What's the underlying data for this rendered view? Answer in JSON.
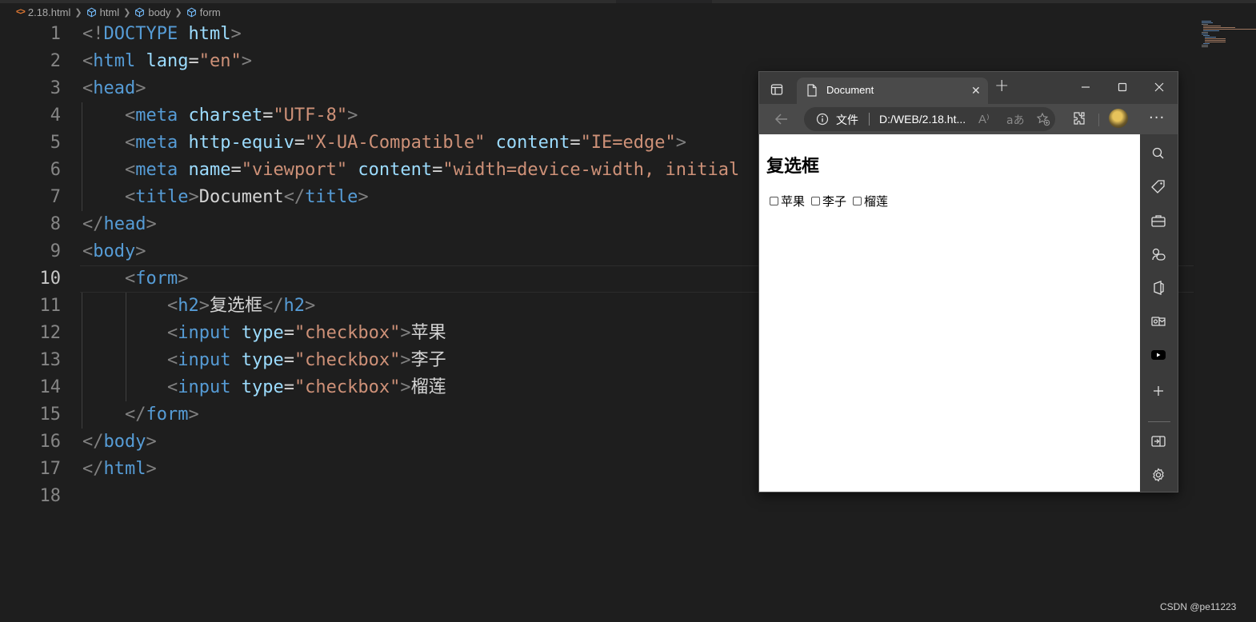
{
  "breadcrumb": {
    "file": "2.18.html",
    "items": [
      "html",
      "body",
      "form"
    ]
  },
  "editor": {
    "active_line": 10,
    "lines": [
      {
        "n": "1",
        "tokens": [
          {
            "c": "p",
            "t": "<!"
          },
          {
            "c": "tg",
            "t": "DOCTYPE"
          },
          {
            "c": "tx",
            "t": " "
          },
          {
            "c": "at",
            "t": "html"
          },
          {
            "c": "p",
            "t": ">"
          }
        ]
      },
      {
        "n": "2",
        "tokens": [
          {
            "c": "p",
            "t": "<"
          },
          {
            "c": "tg",
            "t": "html"
          },
          {
            "c": "tx",
            "t": " "
          },
          {
            "c": "at",
            "t": "lang"
          },
          {
            "c": "eq",
            "t": "="
          },
          {
            "c": "st",
            "t": "\"en\""
          },
          {
            "c": "p",
            "t": ">"
          }
        ]
      },
      {
        "n": "3",
        "tokens": [
          {
            "c": "p",
            "t": "<"
          },
          {
            "c": "tg",
            "t": "head"
          },
          {
            "c": "p",
            "t": ">"
          }
        ]
      },
      {
        "n": "4",
        "tokens": [
          {
            "c": "tx",
            "t": "    "
          },
          {
            "c": "p",
            "t": "<"
          },
          {
            "c": "tg",
            "t": "meta"
          },
          {
            "c": "tx",
            "t": " "
          },
          {
            "c": "at",
            "t": "charset"
          },
          {
            "c": "eq",
            "t": "="
          },
          {
            "c": "st",
            "t": "\"UTF-8\""
          },
          {
            "c": "p",
            "t": ">"
          }
        ]
      },
      {
        "n": "5",
        "tokens": [
          {
            "c": "tx",
            "t": "    "
          },
          {
            "c": "p",
            "t": "<"
          },
          {
            "c": "tg",
            "t": "meta"
          },
          {
            "c": "tx",
            "t": " "
          },
          {
            "c": "at",
            "t": "http-equiv"
          },
          {
            "c": "eq",
            "t": "="
          },
          {
            "c": "st",
            "t": "\"X-UA-Compatible\""
          },
          {
            "c": "tx",
            "t": " "
          },
          {
            "c": "at",
            "t": "content"
          },
          {
            "c": "eq",
            "t": "="
          },
          {
            "c": "st",
            "t": "\"IE=edge\""
          },
          {
            "c": "p",
            "t": ">"
          }
        ]
      },
      {
        "n": "6",
        "tokens": [
          {
            "c": "tx",
            "t": "    "
          },
          {
            "c": "p",
            "t": "<"
          },
          {
            "c": "tg",
            "t": "meta"
          },
          {
            "c": "tx",
            "t": " "
          },
          {
            "c": "at",
            "t": "name"
          },
          {
            "c": "eq",
            "t": "="
          },
          {
            "c": "st",
            "t": "\"viewport\""
          },
          {
            "c": "tx",
            "t": " "
          },
          {
            "c": "at",
            "t": "content"
          },
          {
            "c": "eq",
            "t": "="
          },
          {
            "c": "st",
            "t": "\"width=device-width, initial"
          }
        ]
      },
      {
        "n": "7",
        "tokens": [
          {
            "c": "tx",
            "t": "    "
          },
          {
            "c": "p",
            "t": "<"
          },
          {
            "c": "tg",
            "t": "title"
          },
          {
            "c": "p",
            "t": ">"
          },
          {
            "c": "tx",
            "t": "Document"
          },
          {
            "c": "p",
            "t": "</"
          },
          {
            "c": "tg",
            "t": "title"
          },
          {
            "c": "p",
            "t": ">"
          }
        ]
      },
      {
        "n": "8",
        "tokens": [
          {
            "c": "p",
            "t": "</"
          },
          {
            "c": "tg",
            "t": "head"
          },
          {
            "c": "p",
            "t": ">"
          }
        ]
      },
      {
        "n": "9",
        "tokens": [
          {
            "c": "p",
            "t": "<"
          },
          {
            "c": "tg",
            "t": "body"
          },
          {
            "c": "p",
            "t": ">"
          }
        ]
      },
      {
        "n": "10",
        "tokens": [
          {
            "c": "tx",
            "t": "    "
          },
          {
            "c": "p",
            "t": "<"
          },
          {
            "c": "tg",
            "t": "form"
          },
          {
            "c": "p",
            "t": ">"
          }
        ]
      },
      {
        "n": "11",
        "tokens": [
          {
            "c": "tx",
            "t": "        "
          },
          {
            "c": "p",
            "t": "<"
          },
          {
            "c": "tg",
            "t": "h2"
          },
          {
            "c": "p",
            "t": ">"
          },
          {
            "c": "tx",
            "t": "复选框"
          },
          {
            "c": "p",
            "t": "</"
          },
          {
            "c": "tg",
            "t": "h2"
          },
          {
            "c": "p",
            "t": ">"
          }
        ]
      },
      {
        "n": "12",
        "tokens": [
          {
            "c": "tx",
            "t": "        "
          },
          {
            "c": "p",
            "t": "<"
          },
          {
            "c": "tg",
            "t": "input"
          },
          {
            "c": "tx",
            "t": " "
          },
          {
            "c": "at",
            "t": "type"
          },
          {
            "c": "eq",
            "t": "="
          },
          {
            "c": "st",
            "t": "\"checkbox\""
          },
          {
            "c": "p",
            "t": ">"
          },
          {
            "c": "tx",
            "t": "苹果"
          }
        ]
      },
      {
        "n": "13",
        "tokens": [
          {
            "c": "tx",
            "t": "        "
          },
          {
            "c": "p",
            "t": "<"
          },
          {
            "c": "tg",
            "t": "input"
          },
          {
            "c": "tx",
            "t": " "
          },
          {
            "c": "at",
            "t": "type"
          },
          {
            "c": "eq",
            "t": "="
          },
          {
            "c": "st",
            "t": "\"checkbox\""
          },
          {
            "c": "p",
            "t": ">"
          },
          {
            "c": "tx",
            "t": "李子"
          }
        ]
      },
      {
        "n": "14",
        "tokens": [
          {
            "c": "tx",
            "t": "        "
          },
          {
            "c": "p",
            "t": "<"
          },
          {
            "c": "tg",
            "t": "input"
          },
          {
            "c": "tx",
            "t": " "
          },
          {
            "c": "at",
            "t": "type"
          },
          {
            "c": "eq",
            "t": "="
          },
          {
            "c": "st",
            "t": "\"checkbox\""
          },
          {
            "c": "p",
            "t": ">"
          },
          {
            "c": "tx",
            "t": "榴莲"
          }
        ]
      },
      {
        "n": "15",
        "tokens": [
          {
            "c": "tx",
            "t": "    "
          },
          {
            "c": "p",
            "t": "</"
          },
          {
            "c": "tg",
            "t": "form"
          },
          {
            "c": "p",
            "t": ">"
          }
        ]
      },
      {
        "n": "16",
        "tokens": [
          {
            "c": "p",
            "t": "</"
          },
          {
            "c": "tg",
            "t": "body"
          },
          {
            "c": "p",
            "t": ">"
          }
        ]
      },
      {
        "n": "17",
        "tokens": [
          {
            "c": "p",
            "t": "</"
          },
          {
            "c": "tg",
            "t": "html"
          },
          {
            "c": "p",
            "t": ">"
          }
        ]
      },
      {
        "n": "18",
        "tokens": []
      }
    ]
  },
  "browser": {
    "tab_title": "Document",
    "address": {
      "scheme_label": "文件",
      "url": "D:/WEB/2.18.ht...",
      "read_aloud_glyph": "A⁾",
      "translate_glyph": "aあ"
    },
    "page": {
      "heading": "复选框",
      "checkboxes": [
        {
          "label": "苹果",
          "checked": false
        },
        {
          "label": "李子",
          "checked": false
        },
        {
          "label": "榴莲",
          "checked": false
        }
      ]
    },
    "sidebar_icons": [
      "search-icon",
      "shopping-tag-icon",
      "tools-icon",
      "games-icon",
      "office-icon",
      "outlook-icon",
      "youtube-icon",
      "add-icon",
      "split-screen-icon",
      "settings-icon"
    ]
  },
  "colors": {
    "editor_bg": "#1e1e1e",
    "tag": "#569cd6",
    "attribute": "#9cdcfe",
    "string": "#ce9178",
    "punctuation": "#808080",
    "browser_chrome": "#3b3b3b"
  },
  "watermark": "CSDN @pe11223"
}
